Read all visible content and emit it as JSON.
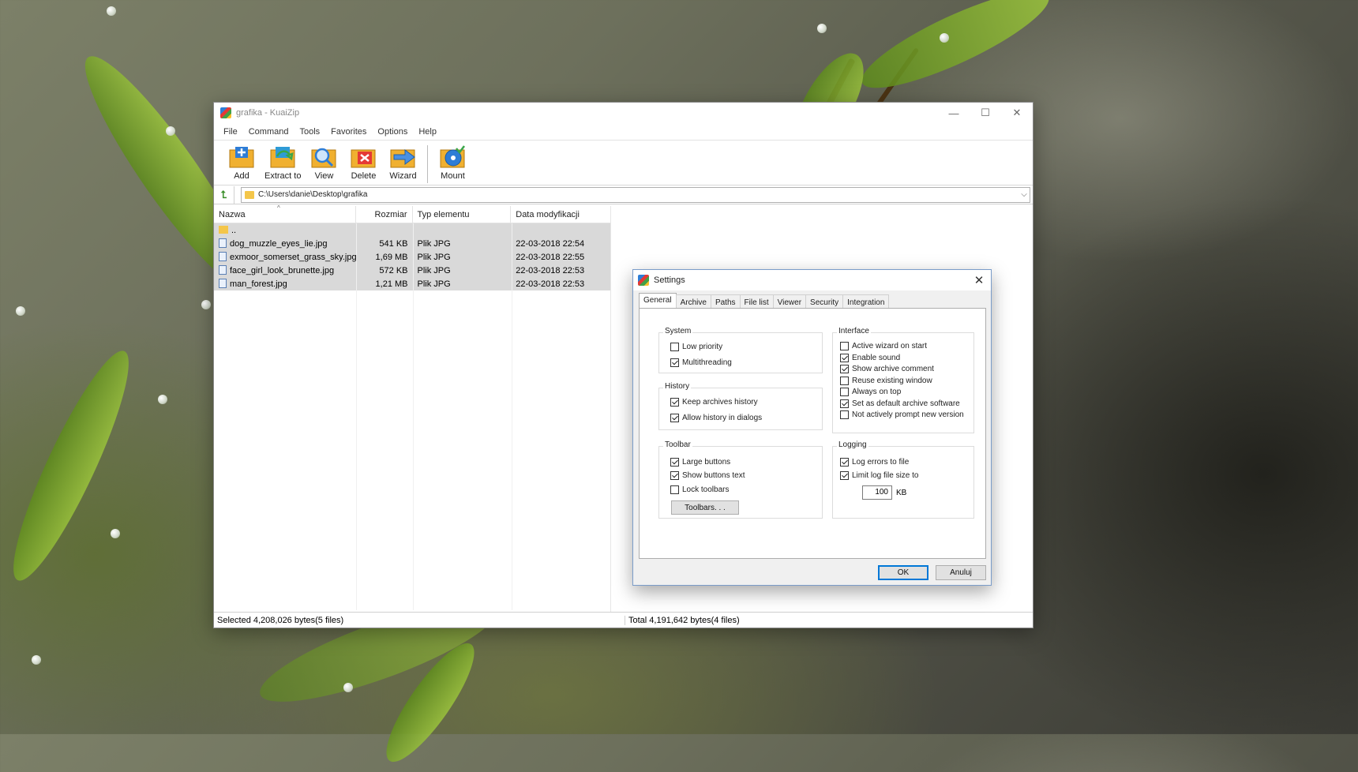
{
  "window": {
    "title": "grafika - KuaiZip",
    "controls": {
      "minimize": "—",
      "maximize": "☐",
      "close": "✕"
    }
  },
  "menu": [
    "File",
    "Command",
    "Tools",
    "Favorites",
    "Options",
    "Help"
  ],
  "toolbar": {
    "add": "Add",
    "extract": "Extract to",
    "view": "View",
    "delete": "Delete",
    "wizard": "Wizard",
    "mount": "Mount"
  },
  "address": {
    "path": "C:\\Users\\danie\\Desktop\\grafika",
    "up_glyph": "⮤",
    "dropdown_glyph": "⌵"
  },
  "filelist": {
    "columns": [
      "Nazwa",
      "Rozmiar",
      "Typ elementu",
      "Data modyfikacji"
    ],
    "sort_glyph": "^",
    "rows": [
      {
        "name": "..",
        "size": "",
        "type": "",
        "date": "",
        "kind": "dir"
      },
      {
        "name": "dog_muzzle_eyes_lie.jpg",
        "size": "541 KB",
        "type": "Plik JPG",
        "date": "22-03-2018 22:54",
        "kind": "file"
      },
      {
        "name": "exmoor_somerset_grass_sky.jpg",
        "size": "1,69 MB",
        "type": "Plik JPG",
        "date": "22-03-2018 22:55",
        "kind": "file"
      },
      {
        "name": "face_girl_look_brunette.jpg",
        "size": "572 KB",
        "type": "Plik JPG",
        "date": "22-03-2018 22:53",
        "kind": "file"
      },
      {
        "name": "man_forest.jpg",
        "size": "1,21 MB",
        "type": "Plik JPG",
        "date": "22-03-2018 22:53",
        "kind": "file"
      }
    ]
  },
  "status": {
    "left": "Selected 4,208,026 bytes(5 files)",
    "right": "Total 4,191,642 bytes(4 files)"
  },
  "settings": {
    "title": "Settings",
    "close": "✕",
    "tabs": [
      "General",
      "Archive",
      "Paths",
      "File list",
      "Viewer",
      "Security",
      "Integration"
    ],
    "system": {
      "label": "System",
      "items": [
        {
          "label": "Low priority",
          "checked": false
        },
        {
          "label": "Multithreading",
          "checked": true
        }
      ]
    },
    "history": {
      "label": "History",
      "items": [
        {
          "label": "Keep archives history",
          "checked": true
        },
        {
          "label": "Allow history in dialogs",
          "checked": true
        }
      ]
    },
    "toolbar": {
      "label": "Toolbar",
      "items": [
        {
          "label": "Large buttons",
          "checked": true
        },
        {
          "label": "Show buttons text",
          "checked": true
        },
        {
          "label": "Lock toolbars",
          "checked": false
        }
      ],
      "button": "Toolbars. . ."
    },
    "interface": {
      "label": "Interface",
      "items": [
        {
          "label": "Active wizard on start",
          "checked": false
        },
        {
          "label": "Enable sound",
          "checked": true
        },
        {
          "label": "Show archive comment",
          "checked": true
        },
        {
          "label": "Reuse existing window",
          "checked": false
        },
        {
          "label": "Always on top",
          "checked": false
        },
        {
          "label": "Set as default archive software",
          "checked": true
        },
        {
          "label": "Not actively prompt new version",
          "checked": false
        }
      ]
    },
    "logging": {
      "label": "Logging",
      "items": [
        {
          "label": "Log errors to file",
          "checked": true
        },
        {
          "label": "Limit log file size to",
          "checked": true
        }
      ],
      "size_value": "100",
      "size_unit": "KB"
    },
    "ok": "OK",
    "cancel": "Anuluj"
  }
}
